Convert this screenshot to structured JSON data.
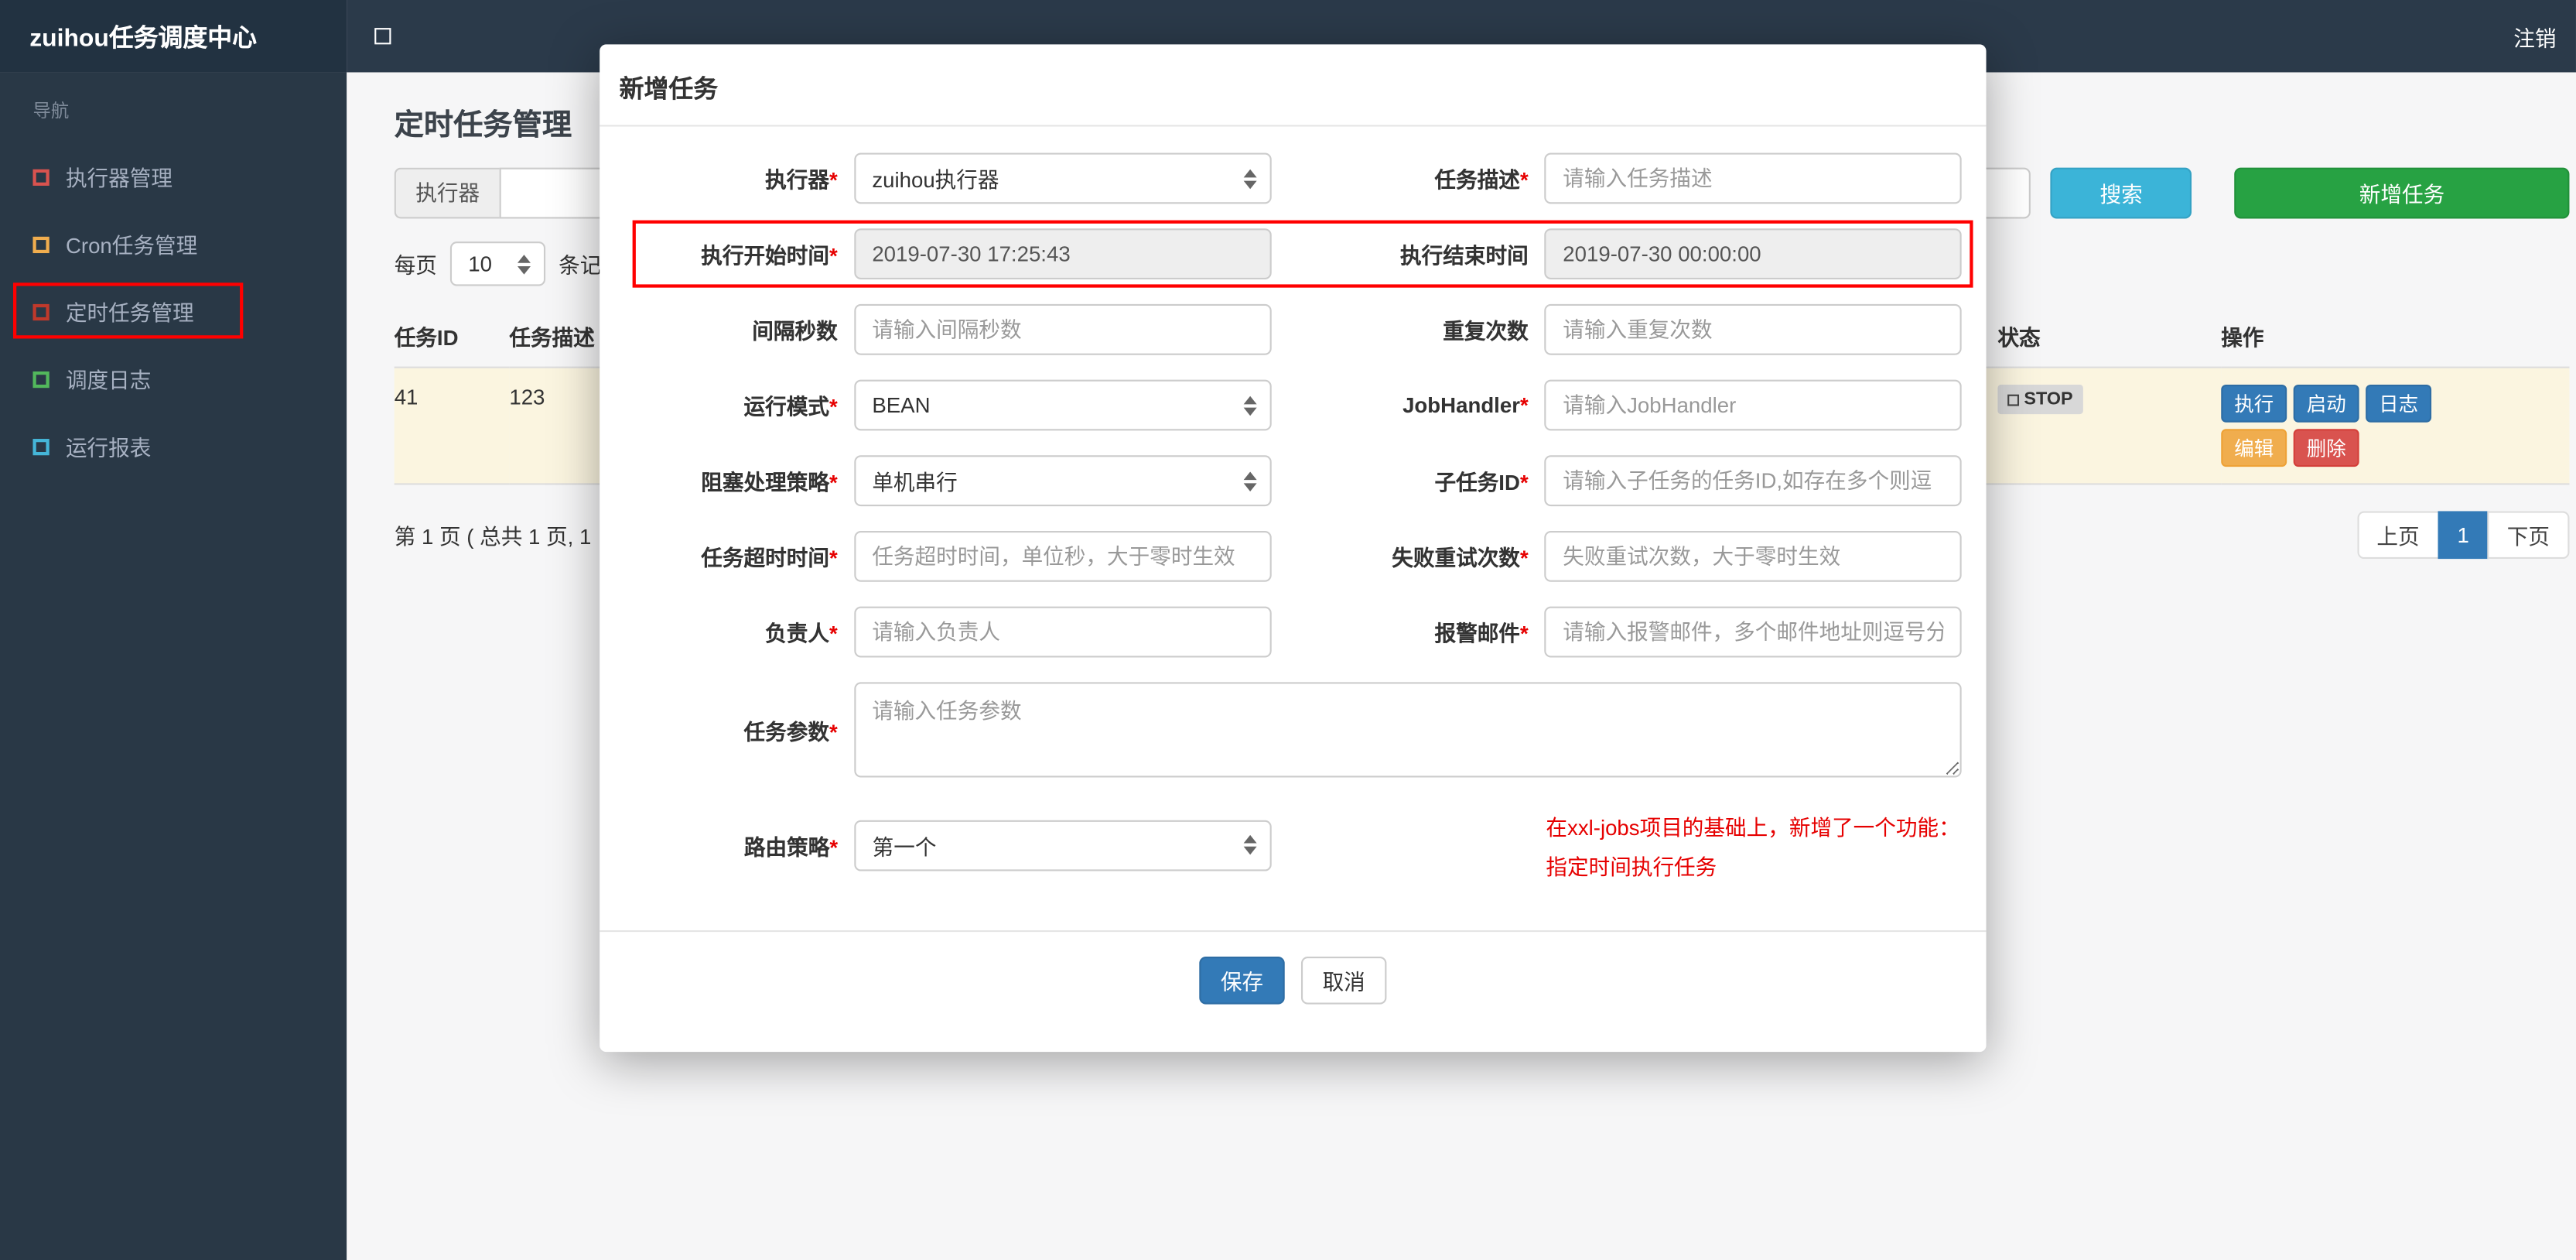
{
  "colors": {
    "navbar_bg": "#2b3a4a",
    "brand_bg": "#223241",
    "sidebar_bg": "#293846",
    "search_button": "#3bb4d8",
    "add_button": "#27a243",
    "save_button": "#337ab7",
    "annotation_red": "#ff0000",
    "row_highlight": "#fbf5e0"
  },
  "navbar": {
    "brand": "zuihou任务调度中心",
    "logout": "注销"
  },
  "sidebar": {
    "nav_label": "导航",
    "items": [
      {
        "label": "执行器管理"
      },
      {
        "label": "Cron任务管理"
      },
      {
        "label": "定时任务管理",
        "active": true
      },
      {
        "label": "调度日志"
      },
      {
        "label": "运行报表"
      }
    ]
  },
  "page": {
    "title": "定时任务管理",
    "filter": {
      "executor_label": "执行器",
      "search_button": "搜索",
      "add_button": "新增任务"
    },
    "per_page": {
      "label": "每页",
      "value": "10",
      "suffix": "条记录"
    },
    "table": {
      "headers": [
        "任务ID",
        "任务描述",
        "状态",
        "操作"
      ],
      "row": {
        "job_id": "41",
        "job_desc": "123",
        "status": "STOP",
        "actions": {
          "run": "执行",
          "start": "启动",
          "log": "日志",
          "edit": "编辑",
          "delete": "删除"
        }
      }
    },
    "pagination": {
      "summary": "第 1 页 ( 总共 1 页, 1",
      "prev": "上页",
      "current": "1",
      "next": "下页"
    }
  },
  "modal": {
    "title": "新增任务",
    "fields": {
      "executor": {
        "label": "执行器",
        "required": "*",
        "value": "zuihou执行器"
      },
      "job_desc": {
        "label": "任务描述",
        "required": "*",
        "placeholder": "请输入任务描述"
      },
      "start_time": {
        "label": "执行开始时间",
        "required": "*",
        "value": "2019-07-30 17:25:43"
      },
      "end_time": {
        "label": "执行结束时间",
        "value": "2019-07-30 00:00:00"
      },
      "interval": {
        "label": "间隔秒数",
        "placeholder": "请输入间隔秒数"
      },
      "repeat": {
        "label": "重复次数",
        "placeholder": "请输入重复次数"
      },
      "run_mode": {
        "label": "运行模式",
        "required": "*",
        "value": "BEAN"
      },
      "job_handler": {
        "label": "JobHandler",
        "required": "*",
        "placeholder": "请输入JobHandler"
      },
      "block_strategy": {
        "label": "阻塞处理策略",
        "required": "*",
        "value": "单机串行"
      },
      "child_job_id": {
        "label": "子任务ID",
        "required": "*",
        "placeholder": "请输入子任务的任务ID,如存在多个则逗"
      },
      "timeout": {
        "label": "任务超时时间",
        "required": "*",
        "placeholder": "任务超时时间，单位秒，大于零时生效"
      },
      "fail_retry": {
        "label": "失败重试次数",
        "required": "*",
        "placeholder": "失败重试次数，大于零时生效"
      },
      "owner": {
        "label": "负责人",
        "required": "*",
        "placeholder": "请输入负责人"
      },
      "alarm_email": {
        "label": "报警邮件",
        "required": "*",
        "placeholder": "请输入报警邮件，多个邮件地址则逗号分"
      },
      "job_params": {
        "label": "任务参数",
        "required": "*",
        "placeholder": "请输入任务参数"
      },
      "route_strategy": {
        "label": "路由策略",
        "required": "*",
        "value": "第一个"
      }
    },
    "note": {
      "line1": "在xxl-jobs项目的基础上，新增了一个功能：",
      "line2": "指定时间执行任务"
    },
    "buttons": {
      "save": "保存",
      "cancel": "取消"
    }
  }
}
